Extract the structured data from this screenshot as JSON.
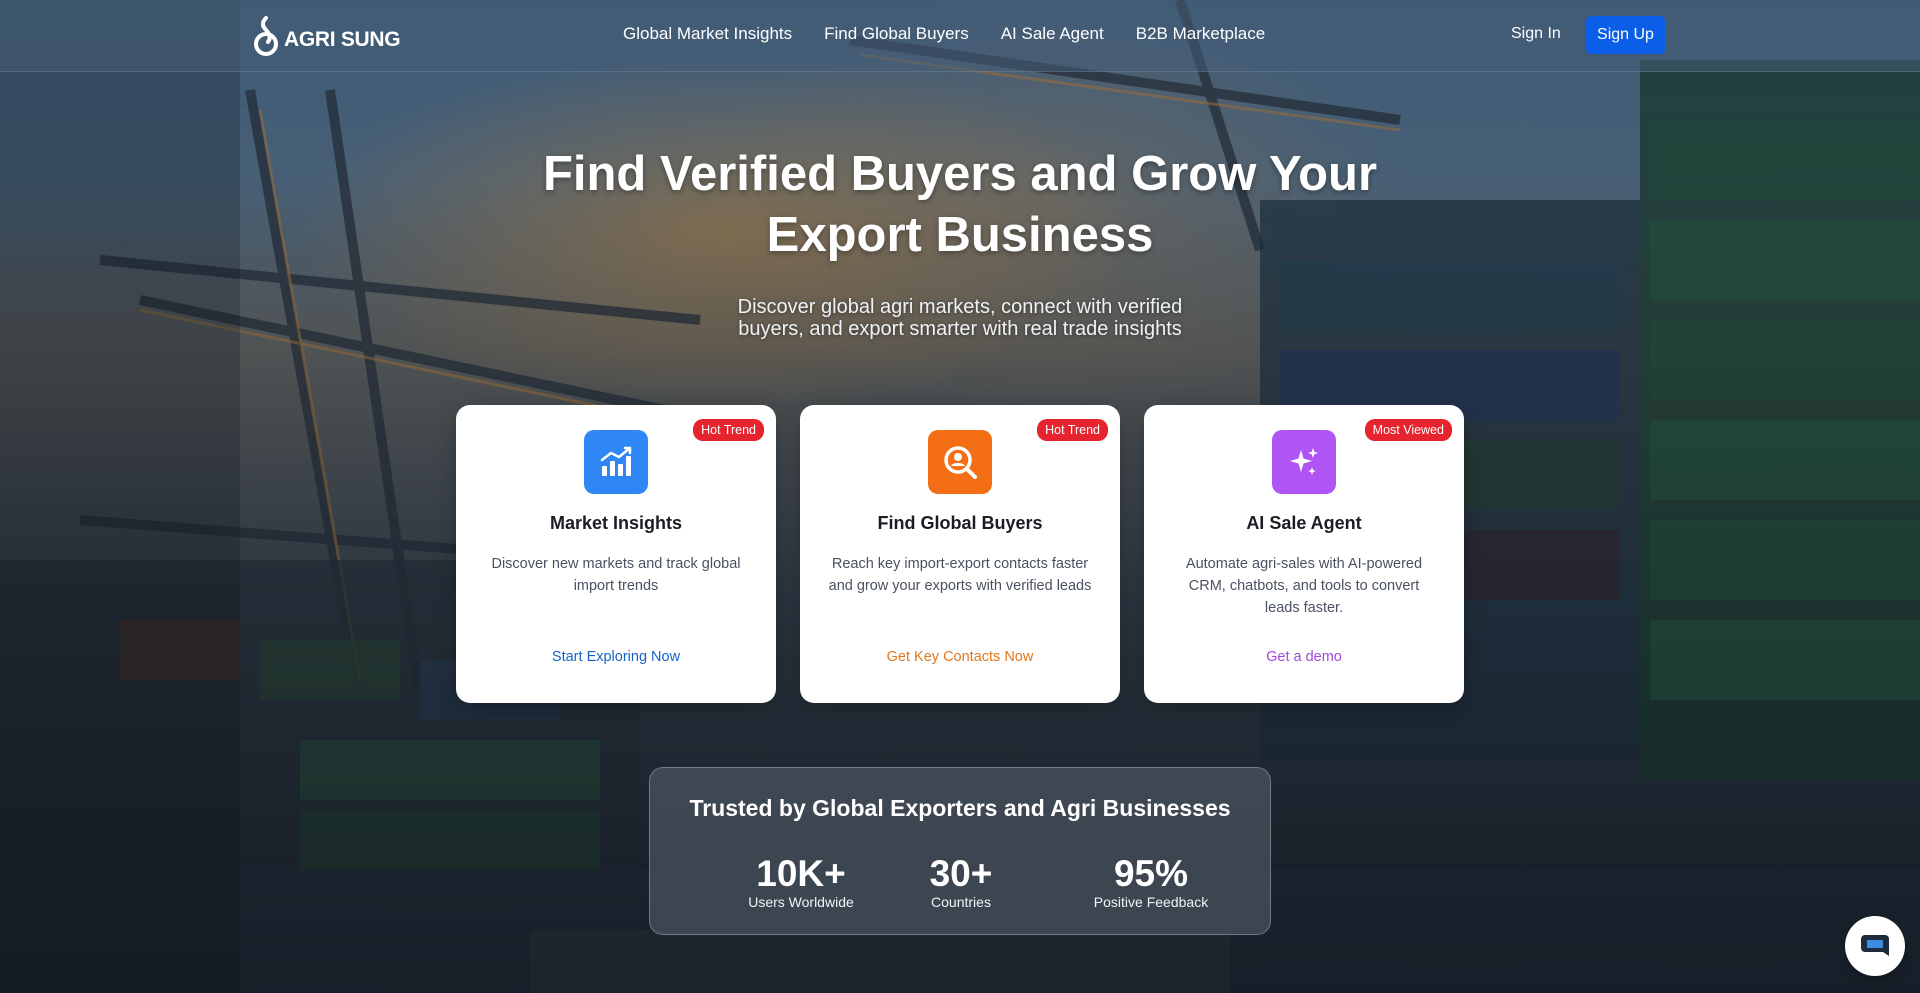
{
  "brand": {
    "name": "AGRI SUNG"
  },
  "nav": {
    "items": [
      {
        "label": "Global Market Insights"
      },
      {
        "label": "Find Global Buyers"
      },
      {
        "label": "AI Sale Agent"
      },
      {
        "label": "B2B Marketplace"
      }
    ],
    "sign_in": "Sign In",
    "sign_up": "Sign Up"
  },
  "hero": {
    "title_line1": "Find Verified Buyers and Grow Your",
    "title_line2": "Export Business",
    "subtitle_line1": "Discover global agri markets, connect with verified",
    "subtitle_line2": "buyers, and export smarter with real trade insights"
  },
  "cards": [
    {
      "badge": "Hot Trend",
      "icon": "chart-trend-icon",
      "title": "Market Insights",
      "description": "Discover new markets and track global import trends",
      "link": "Start Exploring Now",
      "color": "#2f86f5"
    },
    {
      "badge": "Hot Trend",
      "icon": "search-user-icon",
      "title": "Find Global Buyers",
      "description": "Reach key import-export contacts faster and grow your exports with verified leads",
      "link": "Get Key Contacts Now",
      "color": "#f36e14"
    },
    {
      "badge": "Most Viewed",
      "icon": "sparkles-icon",
      "title": "AI Sale Agent",
      "description": "Automate agri-sales with AI-powered CRM, chatbots, and tools to convert leads faster.",
      "link": "Get a demo",
      "color": "#b055f5"
    }
  ],
  "trust": {
    "title": "Trusted by Global Exporters and Agri Businesses",
    "stats": [
      {
        "value": "10K+",
        "label": "Users Worldwide"
      },
      {
        "value": "30+",
        "label": "Countries"
      },
      {
        "value": "95%",
        "label": "Positive Feedback"
      }
    ]
  },
  "colors": {
    "primary": "#0a5ee8",
    "badge": "#e7242e"
  }
}
